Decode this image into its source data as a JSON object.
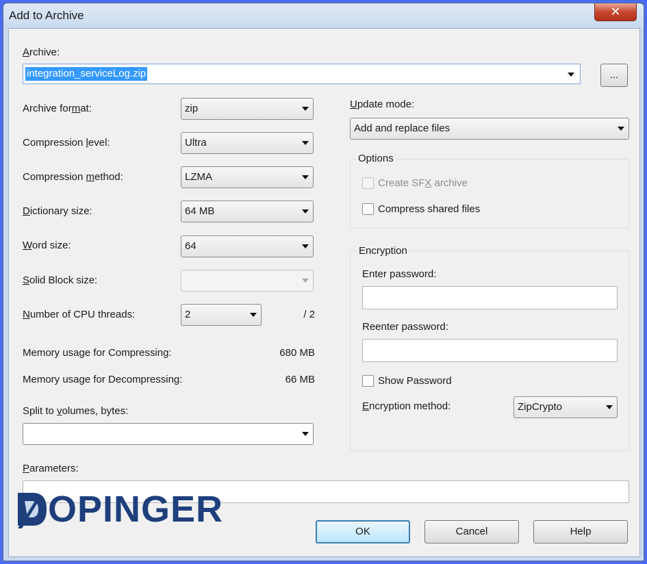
{
  "window": {
    "title": "Add to Archive",
    "close_label": "✕"
  },
  "archive": {
    "label_pre": "",
    "label_u": "A",
    "label_post": "rchive:",
    "value": "integration_serviceLog.zip",
    "browse_label": "..."
  },
  "left": {
    "format": {
      "label_pre": "Archive for",
      "label_u": "m",
      "label_post": "at:",
      "value": "zip"
    },
    "level": {
      "label_pre": "Compression ",
      "label_u": "l",
      "label_post": "evel:",
      "value": "Ultra"
    },
    "method": {
      "label_pre": "Compression ",
      "label_u": "m",
      "label_post": "ethod:",
      "value": "LZMA"
    },
    "dictionary": {
      "label_pre": "",
      "label_u": "D",
      "label_post": "ictionary size:",
      "value": "64 MB"
    },
    "word": {
      "label_pre": "",
      "label_u": "W",
      "label_post": "ord size:",
      "value": "64"
    },
    "solid": {
      "label_pre": "",
      "label_u": "S",
      "label_post": "olid Block size:",
      "value": ""
    },
    "threads": {
      "label_pre": "",
      "label_u": "N",
      "label_post": "umber of CPU threads:",
      "value": "2",
      "max": "/ 2"
    },
    "mem_compress": {
      "label": "Memory usage for Compressing:",
      "value": "680 MB"
    },
    "mem_decompress": {
      "label": "Memory usage for Decompressing:",
      "value": "66 MB"
    },
    "split": {
      "label_pre": "Split to ",
      "label_u": "v",
      "label_post": "olumes, bytes:",
      "value": ""
    },
    "params": {
      "label_pre": "",
      "label_u": "P",
      "label_post": "arameters:",
      "value": ""
    }
  },
  "right": {
    "update": {
      "label_pre": "",
      "label_u": "U",
      "label_post": "pdate mode:",
      "value": "Add and replace files"
    },
    "options": {
      "title": "Options",
      "sfx": {
        "label_pre": "Create SF",
        "label_u": "X",
        "label_post": " archive",
        "checked": false,
        "disabled": true
      },
      "shared": {
        "label": "Compress shared files",
        "checked": false
      }
    },
    "encryption": {
      "title": "Encryption",
      "enter_label": "Enter password:",
      "enter_value": "",
      "reenter_label": "Reenter password:",
      "reenter_value": "",
      "show_label": "Show Password",
      "method_label_pre": "",
      "method_label_u": "E",
      "method_label_post": "ncryption method:",
      "method_value": "ZipCrypto"
    }
  },
  "buttons": {
    "ok": "OK",
    "cancel": "Cancel",
    "help": "Help"
  },
  "logo": {
    "text": "OPINGER",
    "color": "#1e3f7c"
  }
}
